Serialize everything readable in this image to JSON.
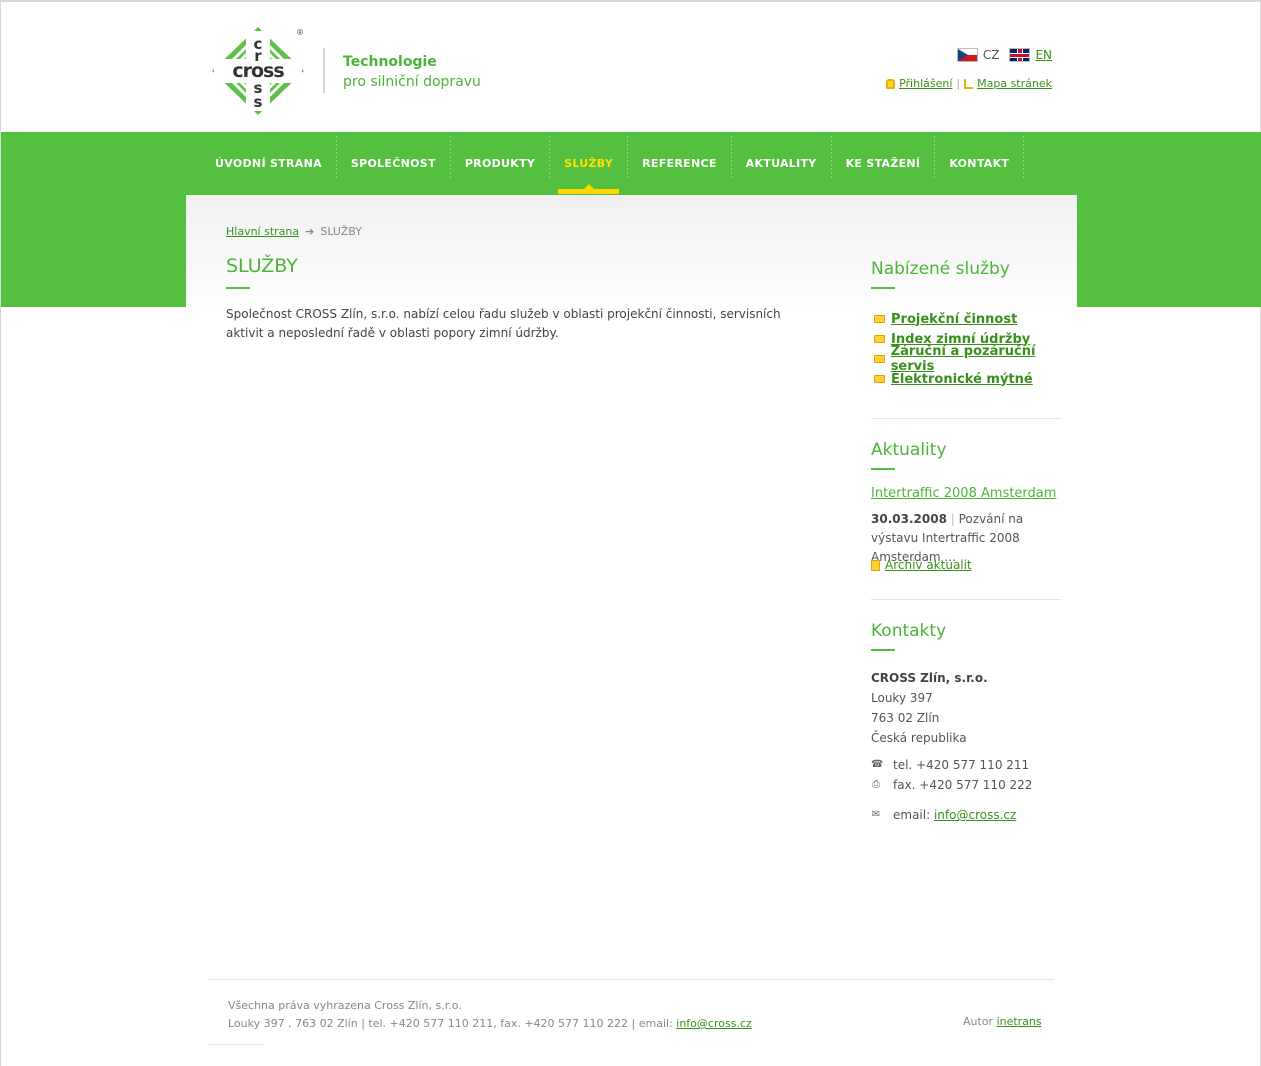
{
  "header": {
    "tagline_line1": "Technologie",
    "tagline_line2": "pro silniční dopravu",
    "lang_cz": "CZ",
    "lang_en": "EN",
    "login": "Přihlášení",
    "sitemap": "Mapa stránek",
    "separator": "|"
  },
  "nav": [
    {
      "label": "ÚVODNÍ STRANA"
    },
    {
      "label": "SPOLEČNOST"
    },
    {
      "label": "PRODUKTY"
    },
    {
      "label": "SLUŽBY",
      "active": true
    },
    {
      "label": "REFERENCE"
    },
    {
      "label": "AKTUALITY"
    },
    {
      "label": "KE STAŽENÍ"
    },
    {
      "label": "KONTAKT"
    }
  ],
  "breadcrumb": {
    "home": "Hlavní strana",
    "arrow": "➔",
    "current": "SLUŽBY"
  },
  "main": {
    "title": "SLUŽBY",
    "intro": "Společnost CROSS Zlín, s.r.o. nabízí celou řadu služeb v oblasti projekční činnosti, servisních aktivit a neposlední řadě v oblasti popory zimní údržby."
  },
  "sidebar": {
    "services_title": "Nabízené služby",
    "services": [
      {
        "label": "Projekční činnost"
      },
      {
        "label": "Index zimní údržby"
      },
      {
        "label": "Záruční a pozáruční servis"
      },
      {
        "label": "Elektronické mýtné"
      }
    ],
    "news_title": "Aktuality",
    "news_item_title": "Intertraffic 2008 Amsterdam",
    "news_date": "30.03.2008",
    "news_bar": "|",
    "news_text": "Pozvání na výstavu Intertraffic 2008 Amsterdam ...",
    "news_archive": "Archiv aktualit",
    "contact_title": "Kontakty",
    "company": "CROSS Zlín, s.r.o.",
    "street": "Louky 397",
    "city": "763 02 Zlín",
    "country": "Česká republika",
    "tel": "tel. +420 577 110 211",
    "fax": "fax. +420 577 110 222",
    "email_label": "email:",
    "email": "info@cross.cz"
  },
  "footer": {
    "rights": "Všechna práva vyhrazena Cross Zlín, s.r.o.",
    "address": "Louky 397 , 763 02 Zlín | tel. +420 577 110 211, fax. +420 577 110 222 | email:",
    "email": "info@cross.cz",
    "author_label": "Autor",
    "author": "inetrans"
  },
  "colors": {
    "brand_green": "#55bf40",
    "link_green": "#3a8f1c",
    "accent_yellow": "#ffd600"
  },
  "icons": [
    "cross-logo-icon",
    "cz-flag-icon",
    "en-flag-icon",
    "lock-icon",
    "sitemap-icon",
    "folder-icon",
    "document-icon",
    "phone-icon",
    "fax-icon",
    "mail-icon"
  ]
}
